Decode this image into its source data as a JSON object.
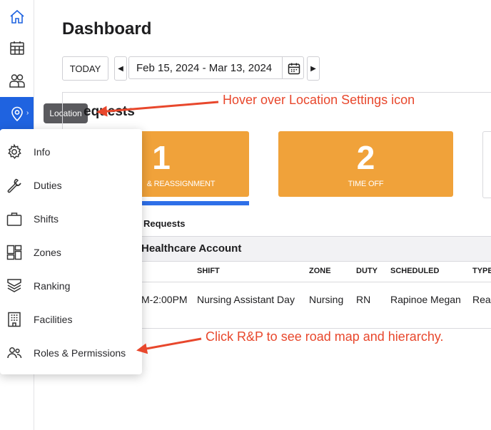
{
  "page": {
    "title": "Dashboard"
  },
  "toolbar": {
    "today_label": "TODAY",
    "prev_icon": "triangle-left-icon",
    "next_icon": "triangle-right-icon",
    "date_range": "Feb 15, 2024 - Mar 13, 2024",
    "calendar_icon": "calendar-icon"
  },
  "sidebar": {
    "items": [
      {
        "icon": "home-icon"
      },
      {
        "icon": "calendar-grid-icon"
      },
      {
        "icon": "people-icon"
      },
      {
        "icon": "location-pin-icon",
        "active": true
      }
    ],
    "tooltip": "Location"
  },
  "requests": {
    "title_visible": "equests",
    "cards": [
      {
        "count": "1",
        "label": "& REASSIGNMENT"
      },
      {
        "count": "2",
        "label": "TIME OFF"
      }
    ],
    "subheading": "Requests",
    "account": "Healthcare Account",
    "columns": [
      "SHIFT",
      "ZONE",
      "DUTY",
      "SCHEDULED",
      "TYPE"
    ],
    "row": {
      "time": "M-2:00PM",
      "shift": "Nursing Assistant Day",
      "zone": "Nursing",
      "duty": "RN",
      "scheduled": "Rapinoe Megan",
      "type": "Reas"
    }
  },
  "menu": {
    "items": [
      {
        "label": "Info",
        "icon": "gear-icon"
      },
      {
        "label": "Duties",
        "icon": "wrench-icon"
      },
      {
        "label": "Shifts",
        "icon": "briefcase-icon"
      },
      {
        "label": "Zones",
        "icon": "zones-grid-icon"
      },
      {
        "label": "Ranking",
        "icon": "stack-chevron-icon"
      },
      {
        "label": "Facilities",
        "icon": "building-icon"
      },
      {
        "label": "Roles & Permissions",
        "icon": "users-icon"
      }
    ]
  },
  "annotations": {
    "hover": "Hover over Location Settings icon",
    "click": "Click R&P to see road map and hierarchy."
  },
  "colors": {
    "accent": "#1f63e0",
    "card": "#f0a23a",
    "annotation": "#e8472c"
  }
}
